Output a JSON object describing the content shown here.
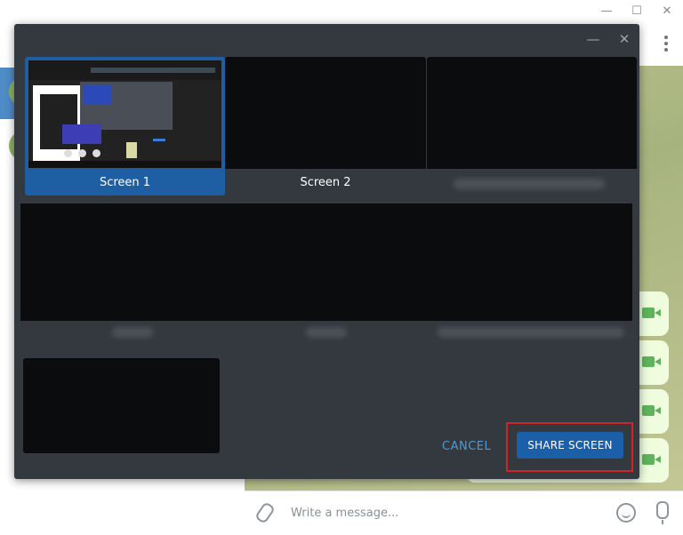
{
  "window": {
    "minimize_glyph": "—",
    "maximize_glyph": "☐",
    "close_glyph": "✕"
  },
  "dialog": {
    "minimize_glyph": "—",
    "close_glyph": "✕",
    "sources": [
      {
        "label": "Screen 1",
        "selected": true
      },
      {
        "label": "Screen 2",
        "selected": false
      }
    ],
    "cancel_label": "CANCEL",
    "share_label": "SHARE SCREEN"
  },
  "composer": {
    "placeholder": "Write a message..."
  },
  "colors": {
    "accent": "#1b5fa8",
    "selected_tile": "#1e5ea3",
    "dialog_bg": "#33393f",
    "highlight": "#d2232a",
    "chat_bubble": "#effdde"
  },
  "icons": [
    "attach-icon",
    "emoji-icon",
    "microphone-icon",
    "video-call-icon",
    "more-options-icon"
  ]
}
